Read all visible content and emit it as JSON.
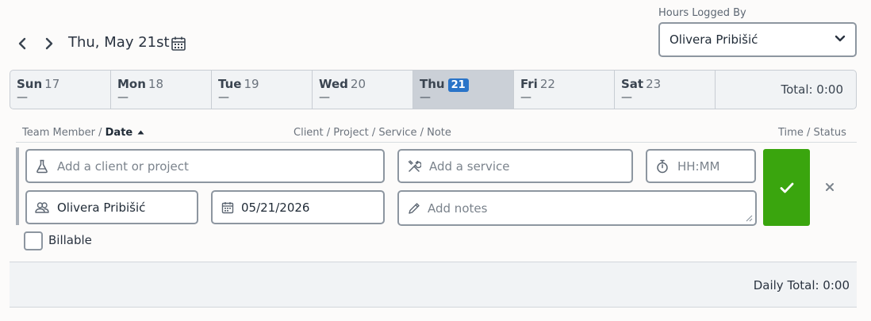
{
  "header": {
    "date_title": "Thu, May 21st",
    "hours_logged_by_label": "Hours Logged By",
    "hours_logged_by_value": "Olivera Pribišić"
  },
  "week": {
    "days": [
      {
        "name": "Sun",
        "date": "17",
        "value": "—",
        "active": false
      },
      {
        "name": "Mon",
        "date": "18",
        "value": "—",
        "active": false
      },
      {
        "name": "Tue",
        "date": "19",
        "value": "—",
        "active": false
      },
      {
        "name": "Wed",
        "date": "20",
        "value": "—",
        "active": false
      },
      {
        "name": "Thu",
        "date": "21",
        "value": "—",
        "active": true
      },
      {
        "name": "Fri",
        "date": "22",
        "value": "—",
        "active": false
      },
      {
        "name": "Sat",
        "date": "23",
        "value": "—",
        "active": false
      }
    ],
    "total": "Total: 0:00"
  },
  "columns": {
    "team_member": "Team Member /",
    "date": "Date",
    "client_project": "Client / Project / Service / Note",
    "time_status": "Time / Status"
  },
  "entry": {
    "client_placeholder": "Add a client or project",
    "service_placeholder": "Add a service",
    "time_placeholder": "HH:MM",
    "team_member": "Olivera Pribišić",
    "date": "05/21/2026",
    "notes_placeholder": "Add notes",
    "billable_label": "Billable"
  },
  "footer": {
    "daily_total": "Daily Total: 0:00"
  },
  "colors": {
    "accent_blue": "#2a74c8",
    "save_green": "#3aa50e"
  }
}
